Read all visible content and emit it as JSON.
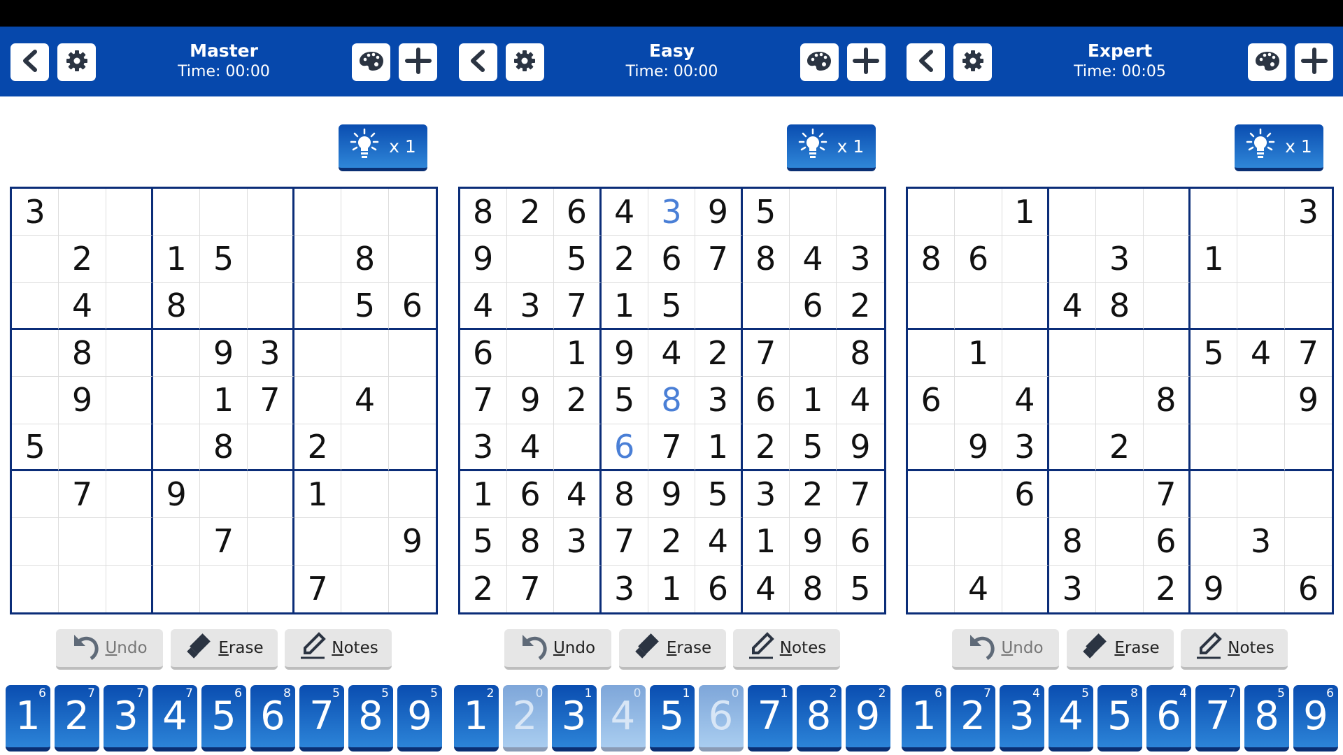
{
  "colors": {
    "header": "#0648ac",
    "grid": "#0b2d78",
    "user_digit": "#4a7fd6"
  },
  "panels": [
    {
      "title": "Master",
      "time": "Time: 00:00",
      "hint_label": "x 1",
      "actions": {
        "undo": "Undo",
        "erase": "Erase",
        "notes": "Notes",
        "undo_enabled": false
      },
      "board": [
        "3........",
        ".2.15..8.",
        ".4.8...56",
        ".8..93...",
        ".9..17.4.",
        "5...8.2..",
        ".7.9..1..",
        "....7...9",
        "......7.."
      ],
      "user_cells": [],
      "pad": [
        {
          "digit": "1",
          "count": "6"
        },
        {
          "digit": "2",
          "count": "7"
        },
        {
          "digit": "3",
          "count": "7"
        },
        {
          "digit": "4",
          "count": "7"
        },
        {
          "digit": "5",
          "count": "6"
        },
        {
          "digit": "6",
          "count": "8"
        },
        {
          "digit": "7",
          "count": "5"
        },
        {
          "digit": "8",
          "count": "5"
        },
        {
          "digit": "9",
          "count": "5"
        }
      ]
    },
    {
      "title": "Easy",
      "time": "Time: 00:00",
      "hint_label": "x 1",
      "actions": {
        "undo": "Undo",
        "erase": "Erase",
        "notes": "Notes",
        "undo_enabled": true
      },
      "board": [
        "8264395..",
        "9.5267843",
        "43715..62",
        "6.19427.8",
        "792583614",
        "34.671259",
        "164895327",
        "583724196",
        "27.316485"
      ],
      "user_cells": [
        [
          0,
          4
        ],
        [
          4,
          4
        ],
        [
          5,
          3
        ]
      ],
      "pad": [
        {
          "digit": "1",
          "count": "2"
        },
        {
          "digit": "2",
          "count": "0"
        },
        {
          "digit": "3",
          "count": "1"
        },
        {
          "digit": "4",
          "count": "0"
        },
        {
          "digit": "5",
          "count": "1"
        },
        {
          "digit": "6",
          "count": "0"
        },
        {
          "digit": "7",
          "count": "1"
        },
        {
          "digit": "8",
          "count": "2"
        },
        {
          "digit": "9",
          "count": "2"
        }
      ]
    },
    {
      "title": "Expert",
      "time": "Time: 00:05",
      "hint_label": "x 1",
      "actions": {
        "undo": "Undo",
        "erase": "Erase",
        "notes": "Notes",
        "undo_enabled": false
      },
      "board": [
        "..1.....3",
        "86..3.1..",
        "...48....",
        ".1....547",
        "6.4..8..9",
        ".93.2....",
        "..6..7...",
        "...8.6.3.",
        ".4.3.29.6"
      ],
      "user_cells": [],
      "pad": [
        {
          "digit": "1",
          "count": "6"
        },
        {
          "digit": "2",
          "count": "7"
        },
        {
          "digit": "3",
          "count": "4"
        },
        {
          "digit": "4",
          "count": "5"
        },
        {
          "digit": "5",
          "count": "8"
        },
        {
          "digit": "6",
          "count": "4"
        },
        {
          "digit": "7",
          "count": "7"
        },
        {
          "digit": "8",
          "count": "5"
        },
        {
          "digit": "9",
          "count": "6"
        }
      ]
    }
  ]
}
